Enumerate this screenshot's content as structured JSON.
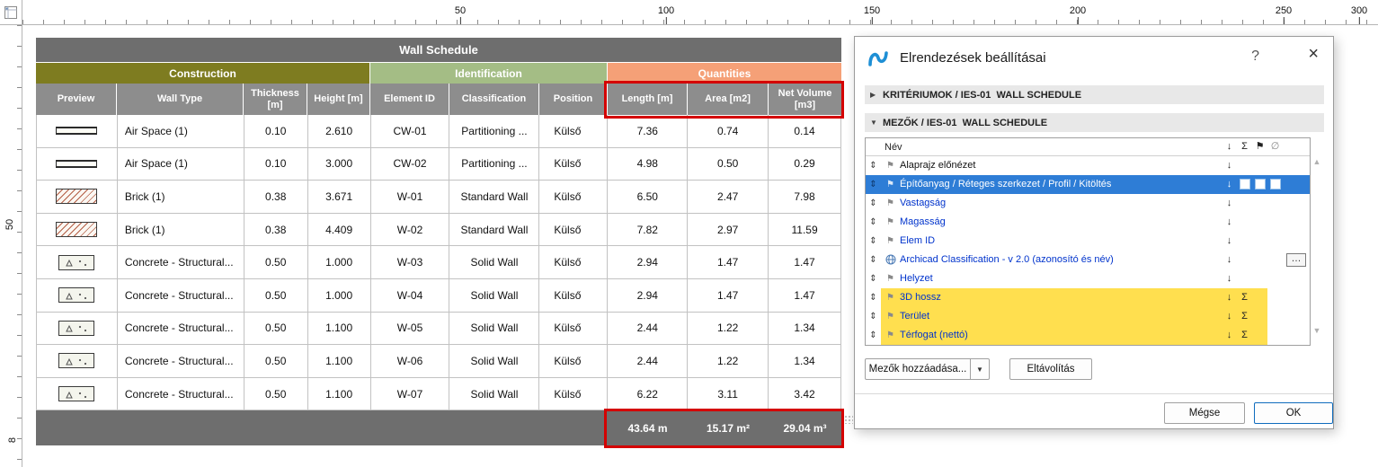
{
  "rulers": {
    "top_marks": [
      "50",
      "100",
      "150",
      "200",
      "250",
      "300"
    ],
    "left_marks": [
      "50",
      "8"
    ]
  },
  "icons": {
    "drag": "⇕",
    "flag": "⚑",
    "sort": "↓",
    "sum": "Σ",
    "hide": "∅",
    "collapsed": "▶",
    "expanded": "▼",
    "dropdown": "▼",
    "more": "…",
    "help": "?",
    "close": "×",
    "scroll_up": "▲",
    "scroll_down": "▼"
  },
  "schedule": {
    "title": "Wall Schedule",
    "groups": [
      {
        "label": "Construction",
        "color": "#7e7c20"
      },
      {
        "label": "Identification",
        "color": "#a4bd85"
      },
      {
        "label": "Quantities",
        "color": "#f5a077"
      }
    ],
    "columns": [
      "Preview",
      "Wall Type",
      "Thickness [m]",
      "Height [m]",
      "Element ID",
      "Classification",
      "Position",
      "Length [m]",
      "Area [m2]",
      "Net Volume [m3]"
    ],
    "rows": [
      {
        "preview": "air-space",
        "wall_type": "Air Space (1)",
        "thickness": "0.10",
        "height": "2.610",
        "element_id": "CW-01",
        "classification": "Partitioning ...",
        "position": "Külső",
        "length": "7.36",
        "area": "0.74",
        "net_volume": "0.14"
      },
      {
        "preview": "air-space",
        "wall_type": "Air Space (1)",
        "thickness": "0.10",
        "height": "3.000",
        "element_id": "CW-02",
        "classification": "Partitioning ...",
        "position": "Külső",
        "length": "4.98",
        "area": "0.50",
        "net_volume": "0.29"
      },
      {
        "preview": "brick",
        "wall_type": "Brick (1)",
        "thickness": "0.38",
        "height": "3.671",
        "element_id": "W-01",
        "classification": "Standard Wall",
        "position": "Külső",
        "length": "6.50",
        "area": "2.47",
        "net_volume": "7.98"
      },
      {
        "preview": "brick",
        "wall_type": "Brick (1)",
        "thickness": "0.38",
        "height": "4.409",
        "element_id": "W-02",
        "classification": "Standard Wall",
        "position": "Külső",
        "length": "7.82",
        "area": "2.97",
        "net_volume": "11.59"
      },
      {
        "preview": "concrete",
        "wall_type": "Concrete - Structural...",
        "thickness": "0.50",
        "height": "1.000",
        "element_id": "W-03",
        "classification": "Solid Wall",
        "position": "Külső",
        "length": "2.94",
        "area": "1.47",
        "net_volume": "1.47"
      },
      {
        "preview": "concrete",
        "wall_type": "Concrete - Structural...",
        "thickness": "0.50",
        "height": "1.000",
        "element_id": "W-04",
        "classification": "Solid Wall",
        "position": "Külső",
        "length": "2.94",
        "area": "1.47",
        "net_volume": "1.47"
      },
      {
        "preview": "concrete",
        "wall_type": "Concrete - Structural...",
        "thickness": "0.50",
        "height": "1.100",
        "element_id": "W-05",
        "classification": "Solid Wall",
        "position": "Külső",
        "length": "2.44",
        "area": "1.22",
        "net_volume": "1.34"
      },
      {
        "preview": "concrete",
        "wall_type": "Concrete - Structural...",
        "thickness": "0.50",
        "height": "1.100",
        "element_id": "W-06",
        "classification": "Solid Wall",
        "position": "Külső",
        "length": "2.44",
        "area": "1.22",
        "net_volume": "1.34"
      },
      {
        "preview": "concrete",
        "wall_type": "Concrete - Structural...",
        "thickness": "0.50",
        "height": "1.100",
        "element_id": "W-07",
        "classification": "Solid Wall",
        "position": "Külső",
        "length": "6.22",
        "area": "3.11",
        "net_volume": "3.42"
      }
    ],
    "totals": {
      "length": "43.64 m",
      "area": "15.17 m²",
      "net_volume": "29.04 m³"
    },
    "header_colors": {
      "title_bar": "#6e6e6e",
      "column_header": "#8d8d8d",
      "totals_bar": "#6e6e6e"
    }
  },
  "dialog": {
    "title": "Elrendezések beállításai",
    "sections": [
      {
        "label": "KRITÉRIUMOK / IES-01  WALL SCHEDULE",
        "collapsed": true
      },
      {
        "label": "MEZŐK / IES-01  WALL SCHEDULE",
        "collapsed": false
      }
    ],
    "list": {
      "name_header": "Név",
      "items": [
        {
          "label": "Alaprajz előnézet"
        },
        {
          "label": "Építőanyag / Réteges szerkezet / Profil / Kitöltés",
          "selected": true
        },
        {
          "label": "Vastagság"
        },
        {
          "label": "Magasság"
        },
        {
          "label": "Elem ID"
        },
        {
          "label": "Archicad Classification - v 2.0 (azonosító és név)"
        },
        {
          "label": "Helyzet"
        },
        {
          "label": "3D hossz",
          "summed": true
        },
        {
          "label": "Terület",
          "summed": true
        },
        {
          "label": "Térfogat (nettó)",
          "summed": true
        }
      ],
      "selection_color": "#2e7dd6",
      "sum_highlight_color": "#ffdf4f"
    },
    "buttons": {
      "add_fields": "Mezők hozzáadása...",
      "remove": "Eltávolítás",
      "cancel": "Mégse",
      "ok": "OK"
    }
  },
  "annotations": {
    "highlight_color": "#d40000"
  }
}
